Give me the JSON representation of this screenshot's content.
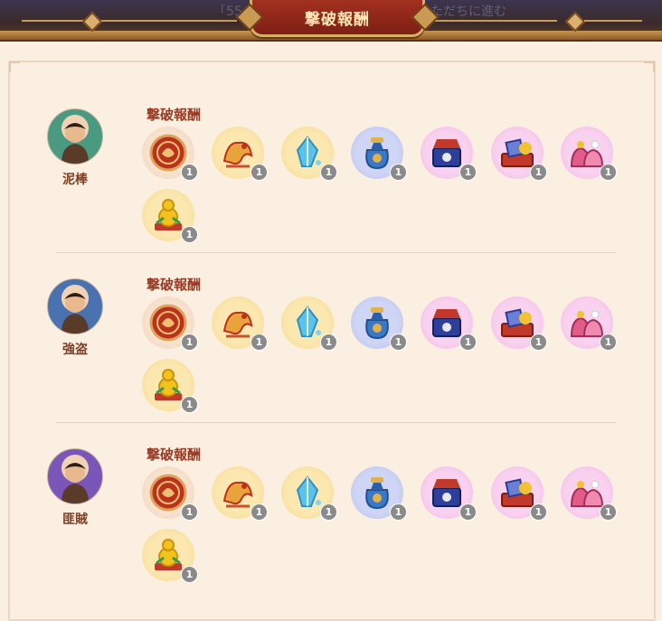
{
  "header": {
    "title": "撃破報酬",
    "bg_left_text": "「55」",
    "bg_right_text": "ただちに進む"
  },
  "section_label": "撃破報酬",
  "reward_icons": [
    {
      "name": "bronze-coin-icon",
      "bg": "plain"
    },
    {
      "name": "gold-dragon-icon",
      "bg": "gold"
    },
    {
      "name": "blue-crystal-icon",
      "bg": "gold"
    },
    {
      "name": "blue-pouch-icon",
      "bg": "blue"
    },
    {
      "name": "treasure-chest-icon",
      "bg": "pink"
    },
    {
      "name": "tribute-box-icon",
      "bg": "pink"
    },
    {
      "name": "gift-bags-icon",
      "bg": "pink"
    },
    {
      "name": "golden-gourd-icon",
      "bg": "gold"
    }
  ],
  "enemies": [
    {
      "name": "泥棒",
      "avatar_bg": "#4a9a82",
      "rewards": [
        1,
        1,
        1,
        1,
        1,
        1,
        1,
        1
      ]
    },
    {
      "name": "強盗",
      "avatar_bg": "#4a72b0",
      "rewards": [
        1,
        1,
        1,
        1,
        1,
        1,
        1,
        1
      ]
    },
    {
      "name": "匪賊",
      "avatar_bg": "#7a56b8",
      "rewards": [
        1,
        1,
        1,
        1,
        1,
        1,
        1,
        1
      ]
    }
  ],
  "colors": {
    "accent": "#9a3a23",
    "count_badge": "#8a8a8a"
  }
}
